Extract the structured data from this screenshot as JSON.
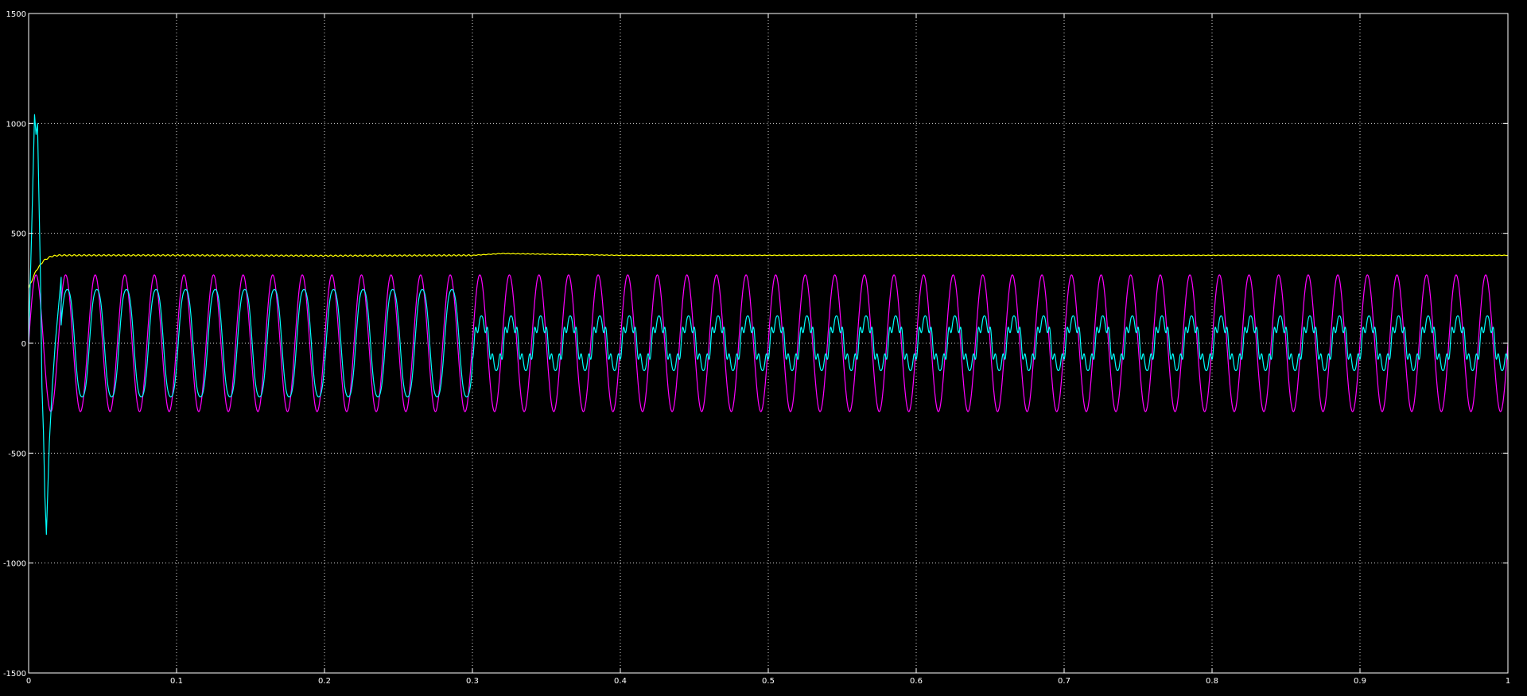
{
  "chart_data": {
    "type": "line",
    "title": "",
    "xlabel": "",
    "ylabel": "",
    "xlim": [
      0,
      1
    ],
    "ylim": [
      -1500,
      1500
    ],
    "grid": true,
    "background_color": "#000000",
    "axis_color": "#ffffff",
    "x_ticks": [
      0,
      0.1,
      0.2,
      0.3,
      0.4,
      0.5,
      0.6,
      0.7,
      0.8,
      0.9,
      1
    ],
    "x_tick_labels": [
      "0",
      "0.1",
      "0.2",
      "0.3",
      "0.4",
      "0.5",
      "0.6",
      "0.7",
      "0.8",
      "0.9",
      "1"
    ],
    "y_ticks": [
      -1500,
      -1000,
      -500,
      0,
      500,
      1000,
      1500
    ],
    "y_tick_labels": [
      "-1500",
      "-1000",
      "-500",
      "0",
      "500",
      "1000",
      "1500"
    ],
    "series": [
      {
        "color": "#ffff00",
        "description_values": {
          "x": [
            0,
            0.005,
            0.01,
            0.015,
            0.02,
            0.05,
            0.1,
            0.2,
            0.3,
            0.32,
            0.4,
            0.5,
            0.6,
            0.7,
            0.8,
            0.9,
            1.0
          ],
          "y": [
            250,
            330,
            375,
            395,
            400,
            400,
            400,
            398,
            400,
            408,
            400,
            400,
            400,
            400,
            400,
            400,
            400
          ]
        }
      },
      {
        "color": "#ff00ff",
        "shape": "sine",
        "amplitude": 311,
        "frequency_hz": 50,
        "offset": 0,
        "x_range": [
          0,
          1
        ]
      },
      {
        "color": "#00ffff",
        "shape": "sine-segments",
        "frequency_hz": 50,
        "phase_lag_rad": 0.35,
        "startup": {
          "x": [
            0,
            0.002,
            0.004,
            0.005,
            0.006,
            0.008,
            0.009,
            0.01,
            0.011,
            0.012,
            0.014,
            0.016,
            0.018,
            0.02,
            0.022
          ],
          "y": [
            0,
            500,
            1040,
            950,
            1000,
            300,
            -200,
            -400,
            -700,
            -870,
            -450,
            -200,
            0,
            150,
            300
          ]
        },
        "segments": [
          {
            "x_start": 0.022,
            "x_end": 0.3,
            "amplitude": 260
          },
          {
            "x_start": 0.3,
            "x_end": 1.0,
            "amplitude": 110
          }
        ]
      }
    ]
  }
}
